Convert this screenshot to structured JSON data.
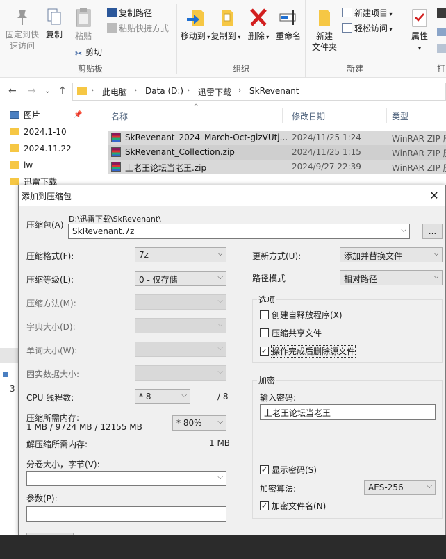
{
  "ribbon": {
    "clipboard": {
      "pin_label_1": "固定到快",
      "pin_label_2": "速访问",
      "copy": "复制",
      "paste": "粘贴",
      "copy_path": "复制路径",
      "paste_shortcut": "粘贴快捷方式",
      "cut": "剪切",
      "group": "剪贴板"
    },
    "organize": {
      "move_to": "移动到",
      "copy_to": "复制到",
      "delete": "删除",
      "rename": "重命名",
      "group": "组织"
    },
    "new": {
      "new_folder_1": "新建",
      "new_folder_2": "文件夹",
      "new_item": "新建项目",
      "easy_access": "轻松访问",
      "group": "新建"
    },
    "open": {
      "properties": "属性",
      "group": "打"
    }
  },
  "address": {
    "crumbs": [
      "此电脑",
      "Data (D:)",
      "迅雷下载",
      "SkRevenant"
    ]
  },
  "nav": {
    "items": [
      "图片",
      "2024.1-10",
      "2024.11.22",
      "lw",
      "迅雷下载"
    ],
    "side_digit": "3"
  },
  "filelist": {
    "col_name": "名称",
    "col_date": "修改日期",
    "col_type": "类型",
    "rows": [
      {
        "name": "SkRevenant_2024_March-Oct-gizVUtj...",
        "date": "2024/11/25 1:24",
        "type": "WinRAR ZIP 压"
      },
      {
        "name": "SkRevenant_Collection.zip",
        "date": "2024/11/25 1:15",
        "type": "WinRAR ZIP 压"
      },
      {
        "name": "上老王论坛当老王.zip",
        "date": "2024/9/27 22:39",
        "type": "WinRAR ZIP 压"
      }
    ]
  },
  "dialog": {
    "title": "添加到压缩包",
    "archive_label": "压缩包(A)",
    "archive_path": "D:\\迅雷下载\\SkRevenant\\",
    "archive_name": "SkRevenant.7z",
    "browse": "...",
    "format_label": "压缩格式(F):",
    "format_value": "7z",
    "level_label": "压缩等级(L):",
    "level_value": "0 - 仅存储",
    "method_label": "压缩方法(M):",
    "dict_label": "字典大小(D):",
    "word_label": "单词大小(W):",
    "solid_label": "固实数据大小:",
    "cpu_label": "CPU 线程数:",
    "cpu_value": "* 8",
    "cpu_total": "/ 8",
    "mem_label": "压缩所需内存:",
    "mem_detail": "1 MB / 9724 MB / 12155 MB",
    "mem_value": "* 80%",
    "decomp_label": "解压缩所需内存:",
    "decomp_value": "1 MB",
    "split_label": "分卷大小，字节(V):",
    "params_label": "参数(P):",
    "update_label": "更新方式(U):",
    "update_value": "添加并替换文件",
    "path_label": "路径模式",
    "path_value": "相对路径",
    "options_title": "选项",
    "opt_sfx": "创建自释放程序(X)",
    "opt_shared": "压缩共享文件",
    "opt_delete": "操作完成后删除源文件",
    "enc_title": "加密",
    "pwd_label": "输入密码:",
    "pwd_value": "上老王论坛当老王",
    "show_pwd": "显示密码(S)",
    "enc_method_label": "加密算法:",
    "enc_method_value": "AES-256",
    "enc_names": "加密文件名(N)",
    "check_mark": "✓"
  }
}
